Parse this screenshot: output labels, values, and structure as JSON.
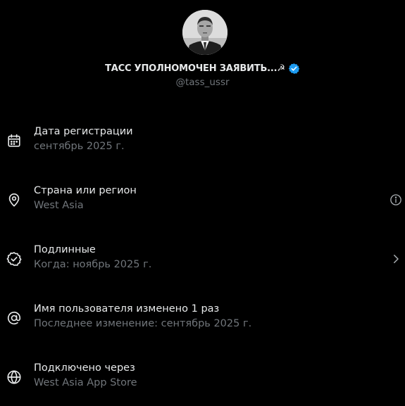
{
  "profile": {
    "display_name": "ТАСС УПОЛНОМОЧЕН ЗАЯВИТЬ...",
    "name_emoji": "☭",
    "handle": "@tass_ussr",
    "verified": true,
    "avatar_icon": "person-portrait-avatar"
  },
  "rows": [
    {
      "icon": "calendar-icon",
      "title": "Дата регистрации",
      "subtitle": "сентябрь 2025 г.",
      "trailing": null
    },
    {
      "icon": "location-pin-icon",
      "title": "Страна или регион",
      "subtitle": "West Asia",
      "trailing": "info-icon"
    },
    {
      "icon": "verified-check-icon",
      "title": "Подлинные",
      "subtitle": "Когда: ноябрь 2025 г.",
      "trailing": "chevron-right-icon"
    },
    {
      "icon": "at-sign-icon",
      "title": "Имя пользователя изменено 1 раз",
      "subtitle": "Последнее изменение: сентябрь 2025 г.",
      "trailing": null
    },
    {
      "icon": "globe-icon",
      "title": "Подключено через",
      "subtitle": "West Asia App Store",
      "trailing": null
    }
  ],
  "colors": {
    "background": "#000000",
    "primary_text": "#e7e9ea",
    "secondary_text": "#71767b",
    "verified_blue": "#1d9bf0"
  }
}
